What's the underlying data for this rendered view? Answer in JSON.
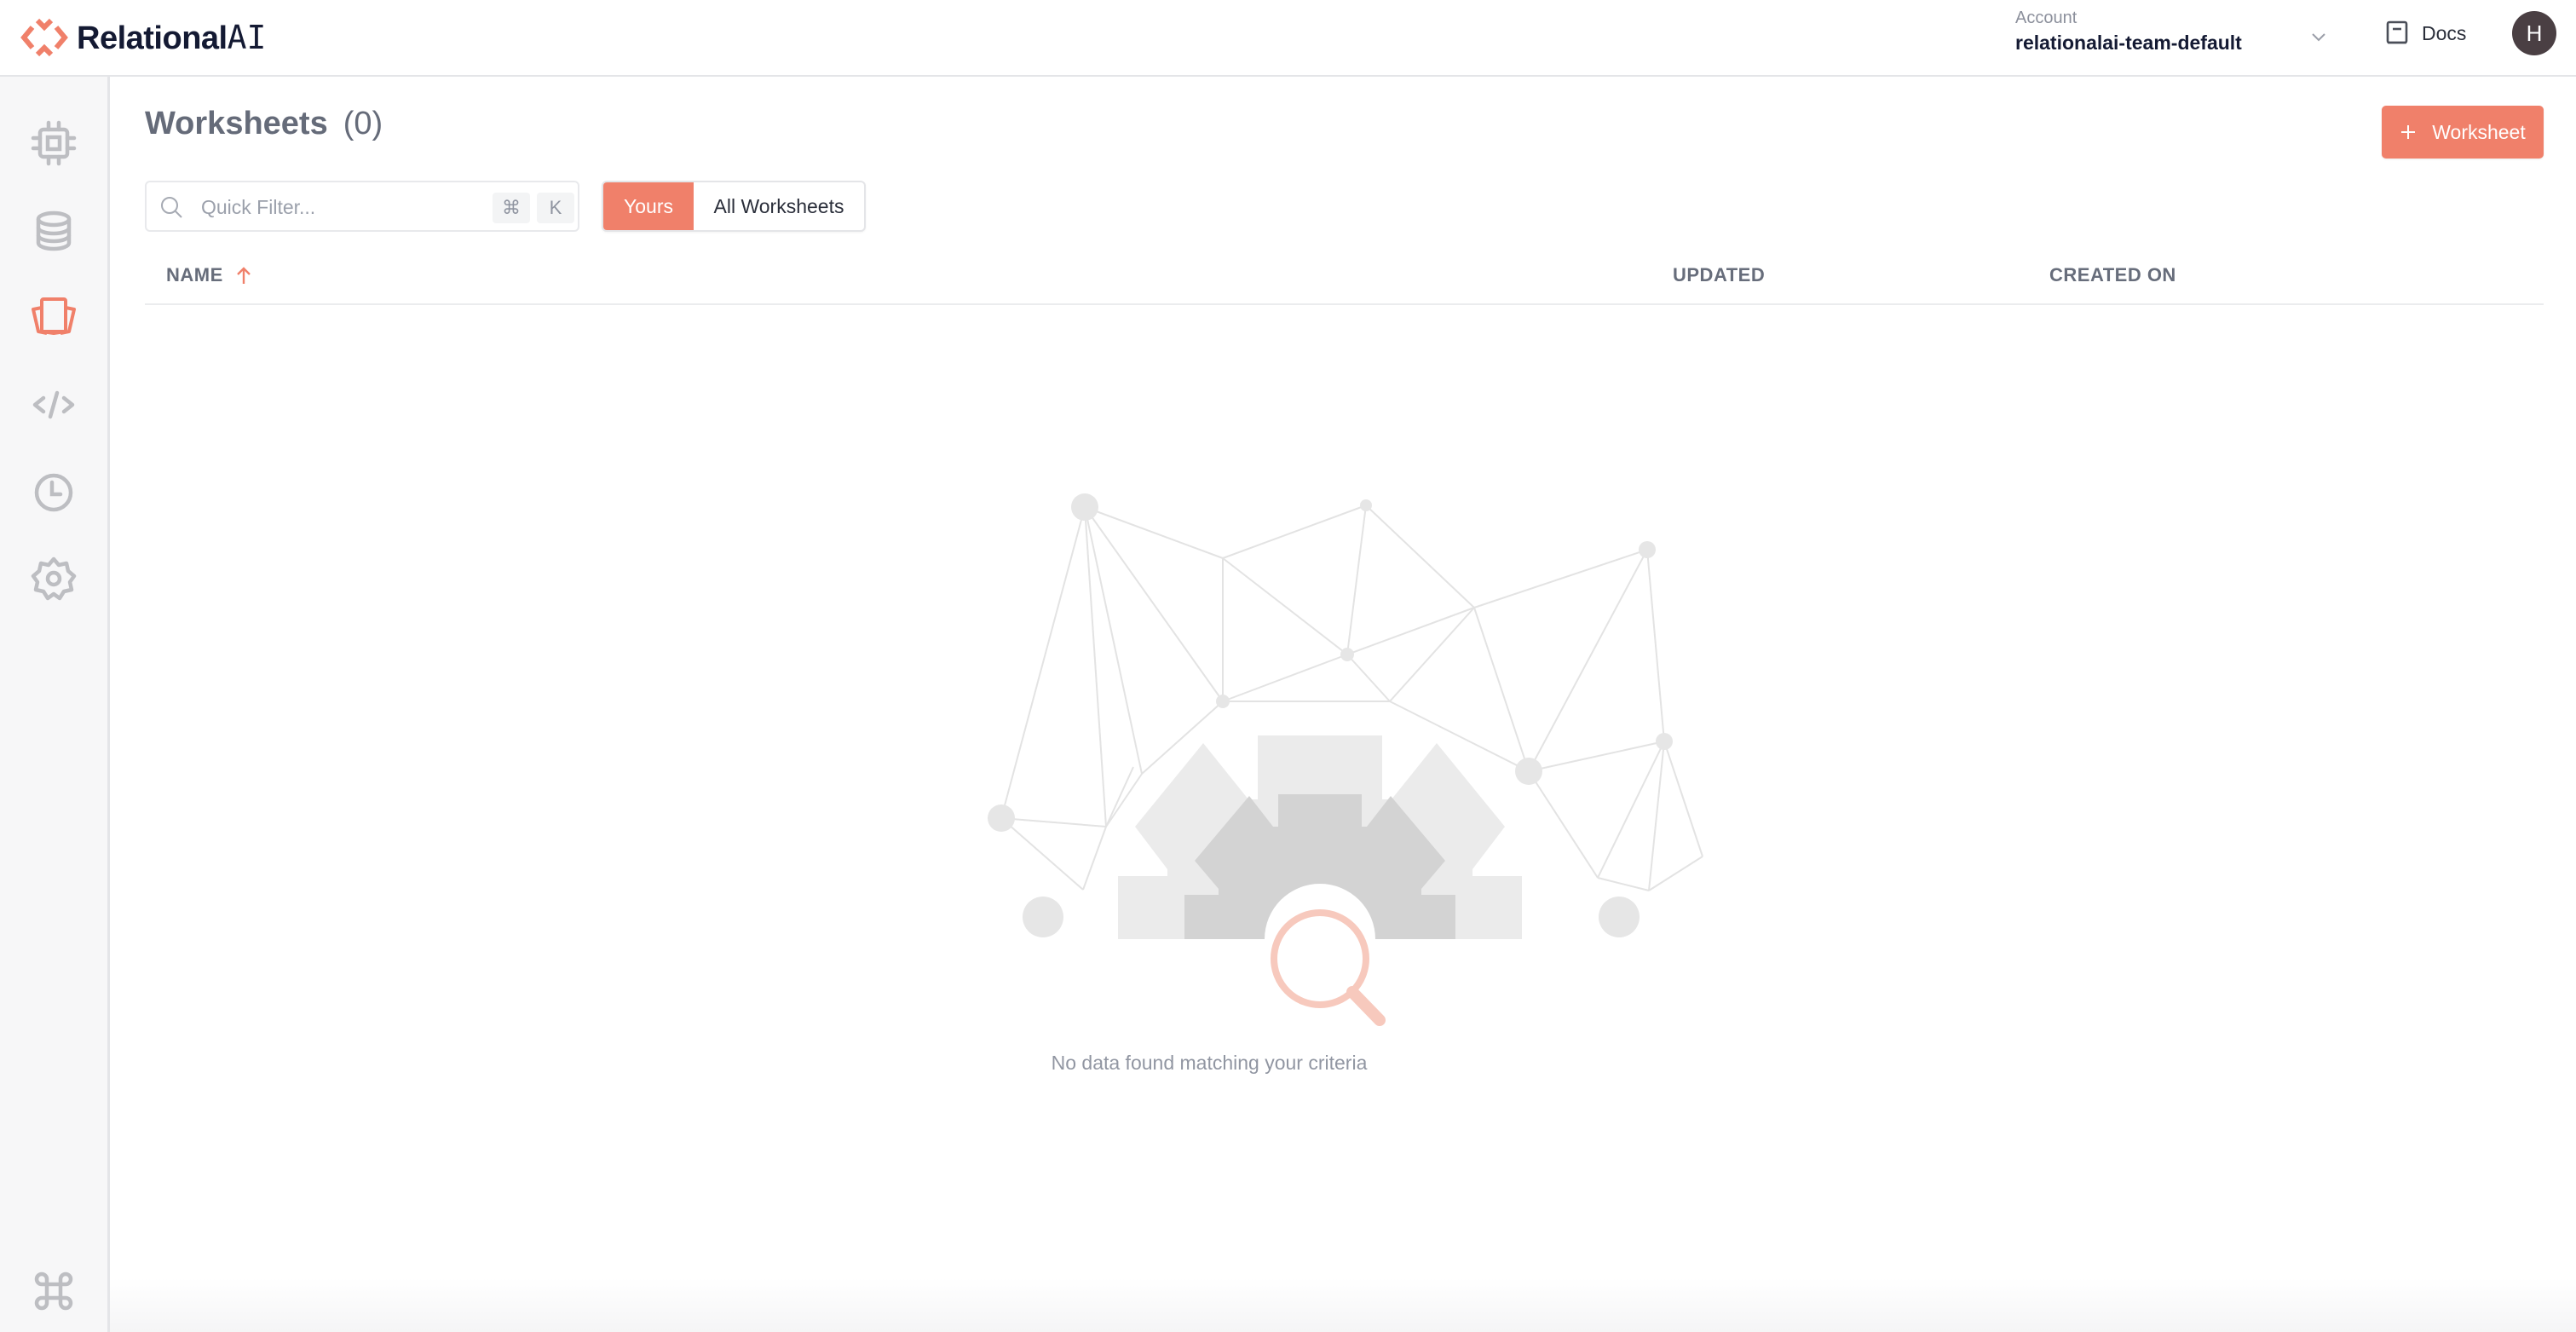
{
  "header": {
    "brand_name": "Relational",
    "brand_suffix": "AI",
    "account_label": "Account",
    "account_name": "relationalai-team-default",
    "docs_label": "Docs",
    "avatar_initial": "H"
  },
  "sidebar": {
    "items": [
      {
        "name": "engines",
        "icon": "chip-icon",
        "active": false
      },
      {
        "name": "databases",
        "icon": "database-icon",
        "active": false
      },
      {
        "name": "worksheets",
        "icon": "worksheets-icon",
        "active": true
      },
      {
        "name": "models",
        "icon": "code-icon",
        "active": false
      },
      {
        "name": "transactions",
        "icon": "clock-icon",
        "active": false
      },
      {
        "name": "settings",
        "icon": "gear-icon",
        "active": false
      }
    ],
    "bottom_icon": "command-icon"
  },
  "page": {
    "title": "Worksheets",
    "count": "(0)",
    "add_button_label": "Worksheet"
  },
  "filter": {
    "placeholder": "Quick Filter...",
    "value": "",
    "shortcut_keys": [
      "⌘",
      "K"
    ]
  },
  "toggle": {
    "options": [
      "Yours",
      "All Worksheets"
    ],
    "selected": "Yours"
  },
  "table": {
    "columns": [
      "NAME",
      "UPDATED",
      "CREATED ON"
    ],
    "sort_column": "NAME",
    "sort_direction": "ascending",
    "rows": []
  },
  "empty_state": {
    "message": "No data found matching your criteria"
  },
  "colors": {
    "accent": "#f0806a",
    "text_muted": "#676d7b",
    "sidebar_icon": "#bdbec2"
  }
}
